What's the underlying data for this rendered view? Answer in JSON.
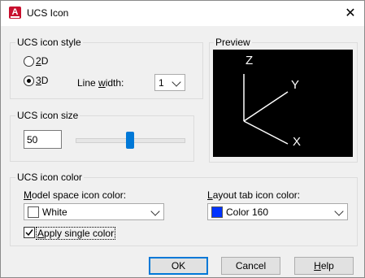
{
  "window": {
    "title": "UCS Icon",
    "app_icon": "autocad-icon",
    "close_glyph": "✕"
  },
  "style_group": {
    "label": "UCS icon style",
    "radio_2d": "2D",
    "radio_3d": "3D",
    "selected": "3D",
    "line_width_label": "Line width:",
    "line_width_value": "1"
  },
  "preview": {
    "label": "Preview",
    "axis_z": "Z",
    "axis_y": "Y",
    "axis_x": "X"
  },
  "size_group": {
    "label": "UCS icon size",
    "value": "50",
    "slider_fraction": 0.5
  },
  "color_group": {
    "label": "UCS icon color",
    "model_label": "Model space icon color:",
    "model_value": "White",
    "model_color": "#ffffff",
    "layout_label": "Layout tab icon color:",
    "layout_value": "Color 160",
    "layout_color": "#0033ff",
    "apply_single_label": "Apply single color",
    "apply_single_checked": true
  },
  "buttons": {
    "ok": "OK",
    "cancel": "Cancel",
    "help": "Help"
  }
}
